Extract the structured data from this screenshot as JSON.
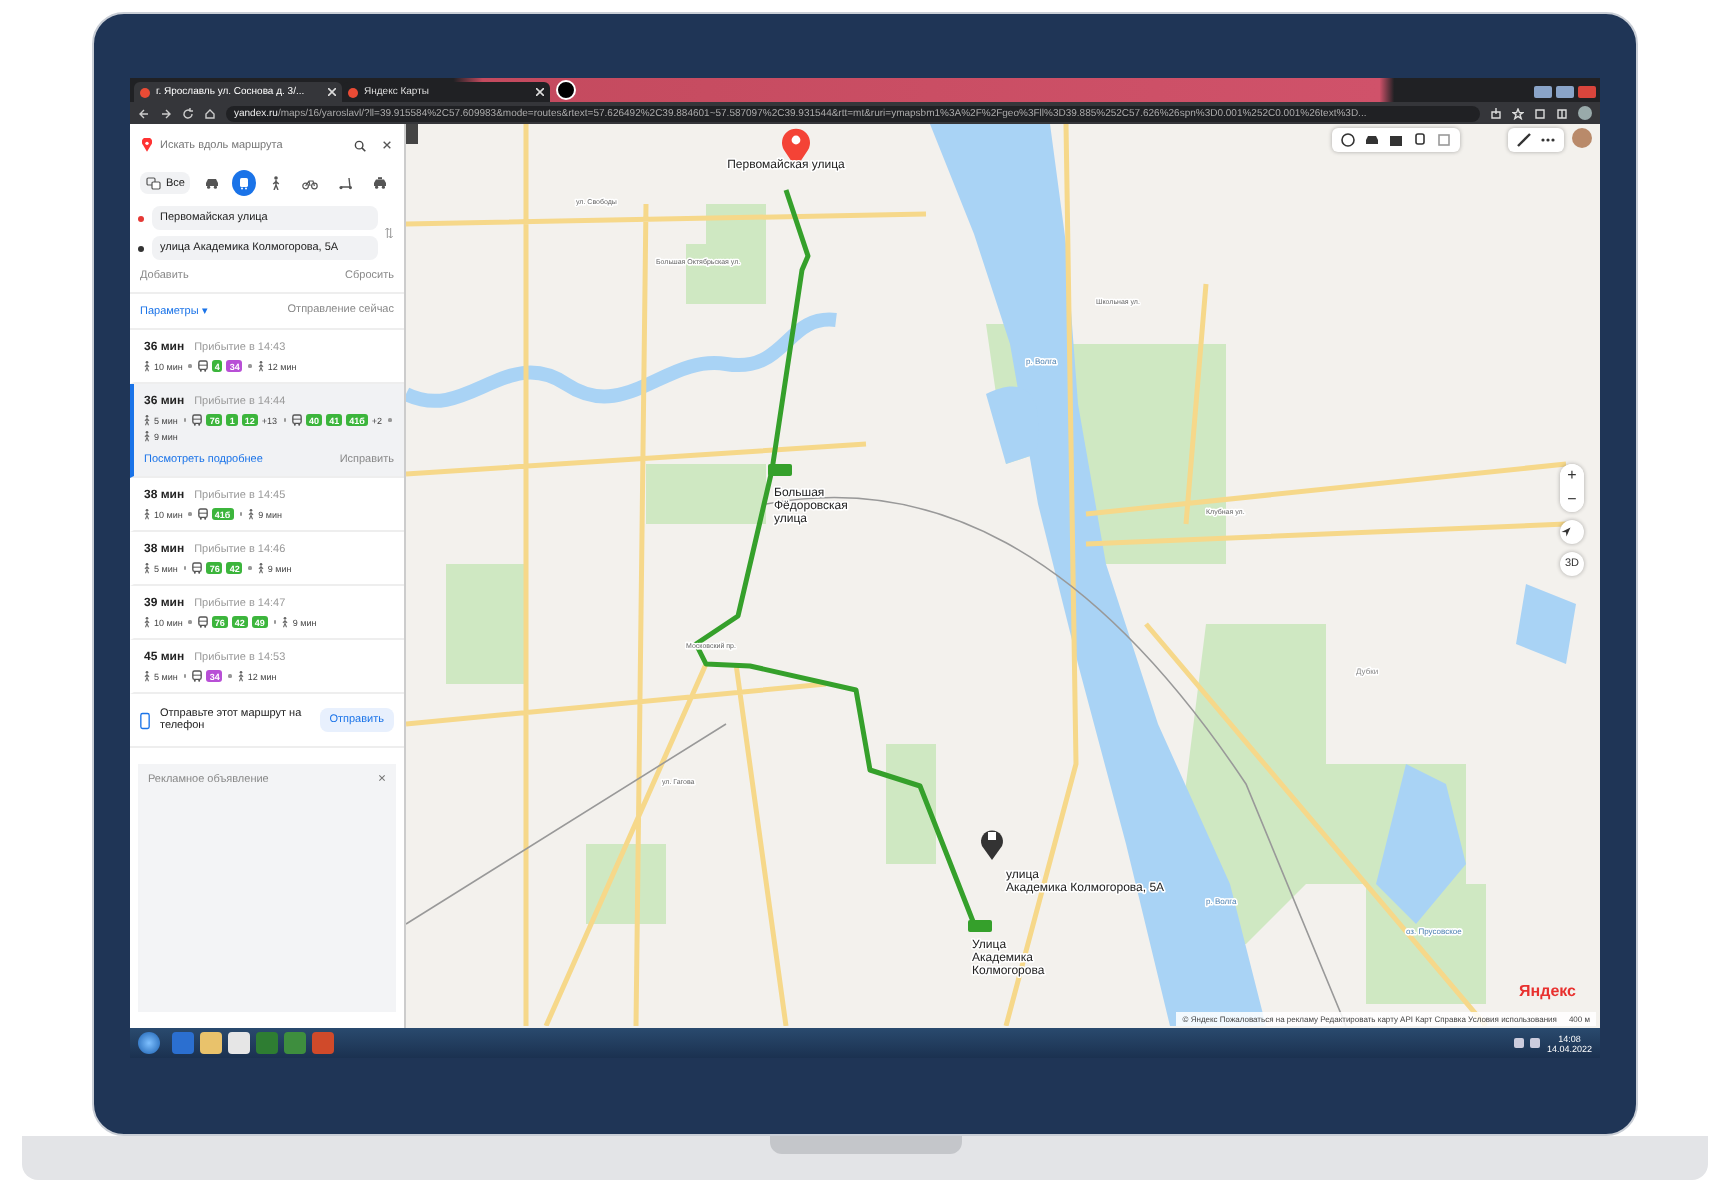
{
  "browser": {
    "tabs": [
      {
        "title": "г. Ярославль ул. Соснова д. 3/...",
        "selected": true
      },
      {
        "title": "Яндекс Карты",
        "selected": false
      }
    ],
    "url": "yandex.ru/maps/16/yaroslavl/?ll=39.915584%2C57.609983&mode=routes&rtext=57.626492%2C39.884601~57.587097%2C39.931544&rtt=mt&ruri=ymapsbm1%3A%2F%2Fgeo%3Fll%3D39.885%252C57.626%26spn%3D0.001%252C0.001%26text%3D..."
  },
  "panel": {
    "search": {
      "placeholder": "Искать вдоль маршрута"
    },
    "modes": [
      {
        "kind": "all",
        "label": "Все",
        "selected": false
      },
      {
        "kind": "car",
        "selected": false
      },
      {
        "kind": "transit",
        "selected": true
      },
      {
        "kind": "walk",
        "selected": false
      },
      {
        "kind": "bike",
        "selected": false
      },
      {
        "kind": "scooter",
        "selected": false
      },
      {
        "kind": "taxi",
        "selected": false
      }
    ],
    "from": "Первомайская улица",
    "to": "улица Академика Колмогорова, 5А",
    "add": "Добавить",
    "reset": "Сбросить",
    "params": "Параметры ▾",
    "departure": "Отправление сейчас",
    "routes": [
      {
        "duration": "36 мин",
        "arrival": "Прибытие в 14:43",
        "selected": false,
        "legs": [
          {
            "kind": "walk",
            "text": "10 мин"
          },
          {
            "kind": "transit",
            "badges": [
              {
                "text": "4",
                "color": "#3cb53c"
              },
              {
                "text": "34",
                "color": "#b84fd6"
              }
            ]
          },
          {
            "kind": "walk",
            "text": "12 мин"
          }
        ]
      },
      {
        "duration": "36 мин",
        "arrival": "Прибытие в 14:44",
        "selected": true,
        "details": "Посмотреть подробнее",
        "fix": "Исправить",
        "legs": [
          {
            "kind": "walk",
            "text": "5 мин"
          },
          {
            "kind": "transit",
            "badges": [
              {
                "text": "76",
                "color": "#3cb53c"
              },
              {
                "text": "1",
                "color": "#3cb53c"
              },
              {
                "text": "12",
                "color": "#3cb53c"
              }
            ],
            "more": "+13"
          },
          {
            "kind": "transit",
            "badges": [
              {
                "text": "40",
                "color": "#3cb53c"
              },
              {
                "text": "41",
                "color": "#3cb53c"
              },
              {
                "text": "41б",
                "color": "#3cb53c"
              }
            ],
            "more": "+2"
          },
          {
            "kind": "walk",
            "text": "9 мин"
          }
        ]
      },
      {
        "duration": "38 мин",
        "arrival": "Прибытие в 14:45",
        "selected": false,
        "legs": [
          {
            "kind": "walk",
            "text": "10 мин"
          },
          {
            "kind": "transit",
            "badges": [
              {
                "text": "41б",
                "color": "#3cb53c"
              }
            ]
          },
          {
            "kind": "walk",
            "text": "9 мин"
          }
        ]
      },
      {
        "duration": "38 мин",
        "arrival": "Прибытие в 14:46",
        "selected": false,
        "legs": [
          {
            "kind": "walk",
            "text": "5 мин"
          },
          {
            "kind": "transit",
            "badges": [
              {
                "text": "76",
                "color": "#3cb53c"
              },
              {
                "text": "42",
                "color": "#3cb53c"
              }
            ]
          },
          {
            "kind": "walk",
            "text": "9 мин"
          }
        ]
      },
      {
        "duration": "39 мин",
        "arrival": "Прибытие в 14:47",
        "selected": false,
        "legs": [
          {
            "kind": "walk",
            "text": "10 мин"
          },
          {
            "kind": "transit",
            "badges": [
              {
                "text": "76",
                "color": "#3cb53c"
              },
              {
                "text": "42",
                "color": "#3cb53c"
              },
              {
                "text": "49",
                "color": "#3cb53c"
              }
            ]
          },
          {
            "kind": "walk",
            "text": "9 мин"
          }
        ]
      },
      {
        "duration": "45 мин",
        "arrival": "Прибытие в 14:53",
        "selected": false,
        "legs": [
          {
            "kind": "walk",
            "text": "5 мин"
          },
          {
            "kind": "transit",
            "badges": [
              {
                "text": "34",
                "color": "#b84fd6"
              }
            ]
          },
          {
            "kind": "walk",
            "text": "12 мин"
          }
        ]
      }
    ],
    "send": {
      "text": "Отправьте этот маршрут на телефон",
      "button": "Отправить"
    },
    "ad": {
      "label": "Рекламное объявление"
    }
  },
  "map": {
    "labels": [
      {
        "kind": "place",
        "text": "Первомайская улица"
      },
      {
        "kind": "stop",
        "text": "Большая Фёдоровская улица"
      },
      {
        "kind": "place",
        "text": "улица Академика Колмогорова, 5А"
      },
      {
        "kind": "stop",
        "text": "Улица Академика Колмогорова"
      },
      {
        "kind": "street",
        "text": "Большая Октябрьская ул."
      },
      {
        "kind": "street",
        "text": "ул. Свободы"
      },
      {
        "kind": "street",
        "text": "Московский пр."
      },
      {
        "kind": "street",
        "text": "ул. Гагова"
      },
      {
        "kind": "street",
        "text": "Клубная ул."
      },
      {
        "kind": "street",
        "text": "Школьная ул."
      },
      {
        "kind": "water",
        "text": "р. Волга"
      },
      {
        "kind": "water",
        "text": "р. Волга"
      },
      {
        "kind": "area",
        "text": "Дубки"
      },
      {
        "kind": "water",
        "text": "оз. Прусовское"
      }
    ],
    "zoom_in": "+",
    "zoom_out": "−",
    "view3d": "3D",
    "logo": "Яндекс",
    "attribution": "© Яндекс  Пожаловаться на рекламу  Редактировать карту  API Карт  Справка  Условия использования",
    "scale": "400 м"
  },
  "taskbar": {
    "time": "14:08",
    "date": "14.04.2022"
  }
}
